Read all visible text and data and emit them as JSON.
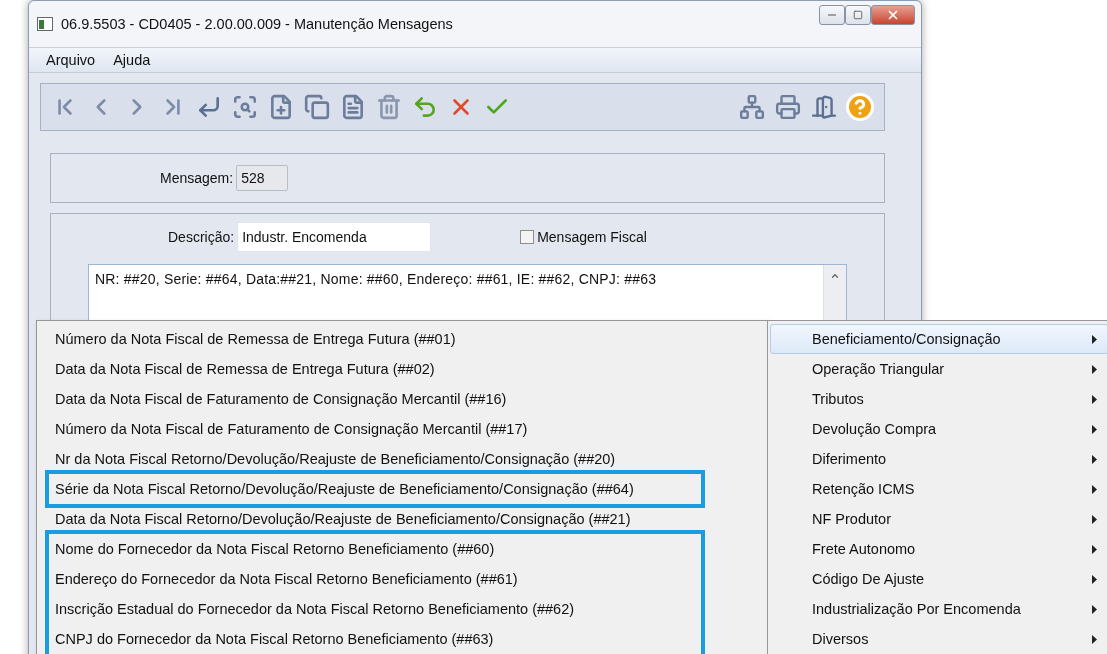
{
  "window": {
    "title": "06.9.5503 - CD0405 - 2.00.00.009 - Manutenção Mensagens"
  },
  "menubar": [
    "Arquivo",
    "Ajuda"
  ],
  "form": {
    "mensagem_label": "Mensagem:",
    "mensagem_value": "528",
    "descricao_label": "Descrição:",
    "descricao_value": "Industr. Encomenda",
    "fiscal_label": "Mensagem Fiscal",
    "fiscal_checked": false,
    "text": "NR: ##20, Serie: ##64, Data:##21, Nome: ##60, Endereço: ##61, IE: ##62, CNPJ: ##63"
  },
  "submenu": [
    {
      "label": "Número da Nota Fiscal de Remessa de Entrega Futura (##01)",
      "highlighted": false
    },
    {
      "label": "Data da Nota Fiscal de Remessa de Entrega Futura (##02)",
      "highlighted": false
    },
    {
      "label": "Data da Nota Fiscal de Faturamento de Consignação Mercantil (##16)",
      "highlighted": false
    },
    {
      "label": "Número da Nota Fiscal de Faturamento de Consignação Mercantil (##17)",
      "highlighted": false
    },
    {
      "label": "Nr da Nota Fiscal Retorno/Devolução/Reajuste de Beneficiamento/Consignação (##20)",
      "highlighted": false
    },
    {
      "label": "Série da Nota Fiscal Retorno/Devolução/Reajuste de Beneficiamento/Consignação (##64)",
      "highlighted": true
    },
    {
      "label": "Data da Nota Fiscal Retorno/Devolução/Reajuste de Beneficiamento/Consignação (##21)",
      "highlighted": false
    },
    {
      "label": "Nome do Fornecedor da Nota Fiscal Retorno Beneficiamento (##60)",
      "highlighted": true
    },
    {
      "label": "Endereço do Fornecedor da Nota Fiscal Retorno Beneficiamento (##61)",
      "highlighted": true
    },
    {
      "label": "Inscrição Estadual do Fornecedor da Nota Fiscal Retorno Beneficiamento (##62)",
      "highlighted": true
    },
    {
      "label": "CNPJ do Fornecedor da Nota Fiscal Retorno Beneficiamento (##63)",
      "highlighted": true
    }
  ],
  "menu": [
    {
      "label": "Beneficiamento/Consignação",
      "selected": true
    },
    {
      "label": "Operação Triangular",
      "selected": false
    },
    {
      "label": "Tributos",
      "selected": false
    },
    {
      "label": "Devolução Compra",
      "selected": false
    },
    {
      "label": "Diferimento",
      "selected": false
    },
    {
      "label": "Retenção ICMS",
      "selected": false
    },
    {
      "label": "NF Produtor",
      "selected": false
    },
    {
      "label": "Frete Autonomo",
      "selected": false
    },
    {
      "label": "Código De Ajuste",
      "selected": false
    },
    {
      "label": "Industrialização Por Encomenda",
      "selected": false
    },
    {
      "label": "Diversos",
      "selected": false
    }
  ]
}
